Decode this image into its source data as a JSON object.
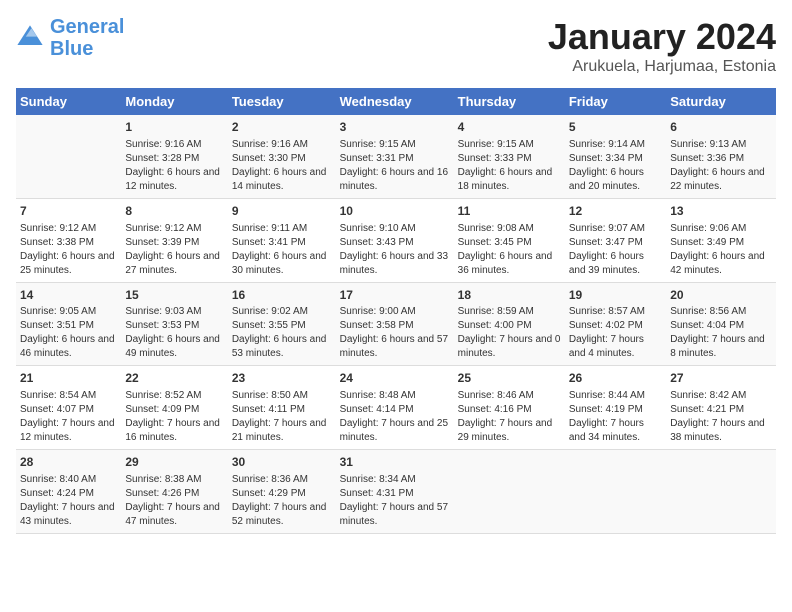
{
  "logo": {
    "line1": "General",
    "line2": "Blue"
  },
  "title": "January 2024",
  "subtitle": "Arukuela, Harjumaa, Estonia",
  "weekdays": [
    "Sunday",
    "Monday",
    "Tuesday",
    "Wednesday",
    "Thursday",
    "Friday",
    "Saturday"
  ],
  "weeks": [
    [
      {
        "day": "",
        "sunrise": "",
        "sunset": "",
        "daylight": ""
      },
      {
        "day": "1",
        "sunrise": "Sunrise: 9:16 AM",
        "sunset": "Sunset: 3:28 PM",
        "daylight": "Daylight: 6 hours and 12 minutes."
      },
      {
        "day": "2",
        "sunrise": "Sunrise: 9:16 AM",
        "sunset": "Sunset: 3:30 PM",
        "daylight": "Daylight: 6 hours and 14 minutes."
      },
      {
        "day": "3",
        "sunrise": "Sunrise: 9:15 AM",
        "sunset": "Sunset: 3:31 PM",
        "daylight": "Daylight: 6 hours and 16 minutes."
      },
      {
        "day": "4",
        "sunrise": "Sunrise: 9:15 AM",
        "sunset": "Sunset: 3:33 PM",
        "daylight": "Daylight: 6 hours and 18 minutes."
      },
      {
        "day": "5",
        "sunrise": "Sunrise: 9:14 AM",
        "sunset": "Sunset: 3:34 PM",
        "daylight": "Daylight: 6 hours and 20 minutes."
      },
      {
        "day": "6",
        "sunrise": "Sunrise: 9:13 AM",
        "sunset": "Sunset: 3:36 PM",
        "daylight": "Daylight: 6 hours and 22 minutes."
      }
    ],
    [
      {
        "day": "7",
        "sunrise": "Sunrise: 9:12 AM",
        "sunset": "Sunset: 3:38 PM",
        "daylight": "Daylight: 6 hours and 25 minutes."
      },
      {
        "day": "8",
        "sunrise": "Sunrise: 9:12 AM",
        "sunset": "Sunset: 3:39 PM",
        "daylight": "Daylight: 6 hours and 27 minutes."
      },
      {
        "day": "9",
        "sunrise": "Sunrise: 9:11 AM",
        "sunset": "Sunset: 3:41 PM",
        "daylight": "Daylight: 6 hours and 30 minutes."
      },
      {
        "day": "10",
        "sunrise": "Sunrise: 9:10 AM",
        "sunset": "Sunset: 3:43 PM",
        "daylight": "Daylight: 6 hours and 33 minutes."
      },
      {
        "day": "11",
        "sunrise": "Sunrise: 9:08 AM",
        "sunset": "Sunset: 3:45 PM",
        "daylight": "Daylight: 6 hours and 36 minutes."
      },
      {
        "day": "12",
        "sunrise": "Sunrise: 9:07 AM",
        "sunset": "Sunset: 3:47 PM",
        "daylight": "Daylight: 6 hours and 39 minutes."
      },
      {
        "day": "13",
        "sunrise": "Sunrise: 9:06 AM",
        "sunset": "Sunset: 3:49 PM",
        "daylight": "Daylight: 6 hours and 42 minutes."
      }
    ],
    [
      {
        "day": "14",
        "sunrise": "Sunrise: 9:05 AM",
        "sunset": "Sunset: 3:51 PM",
        "daylight": "Daylight: 6 hours and 46 minutes."
      },
      {
        "day": "15",
        "sunrise": "Sunrise: 9:03 AM",
        "sunset": "Sunset: 3:53 PM",
        "daylight": "Daylight: 6 hours and 49 minutes."
      },
      {
        "day": "16",
        "sunrise": "Sunrise: 9:02 AM",
        "sunset": "Sunset: 3:55 PM",
        "daylight": "Daylight: 6 hours and 53 minutes."
      },
      {
        "day": "17",
        "sunrise": "Sunrise: 9:00 AM",
        "sunset": "Sunset: 3:58 PM",
        "daylight": "Daylight: 6 hours and 57 minutes."
      },
      {
        "day": "18",
        "sunrise": "Sunrise: 8:59 AM",
        "sunset": "Sunset: 4:00 PM",
        "daylight": "Daylight: 7 hours and 0 minutes."
      },
      {
        "day": "19",
        "sunrise": "Sunrise: 8:57 AM",
        "sunset": "Sunset: 4:02 PM",
        "daylight": "Daylight: 7 hours and 4 minutes."
      },
      {
        "day": "20",
        "sunrise": "Sunrise: 8:56 AM",
        "sunset": "Sunset: 4:04 PM",
        "daylight": "Daylight: 7 hours and 8 minutes."
      }
    ],
    [
      {
        "day": "21",
        "sunrise": "Sunrise: 8:54 AM",
        "sunset": "Sunset: 4:07 PM",
        "daylight": "Daylight: 7 hours and 12 minutes."
      },
      {
        "day": "22",
        "sunrise": "Sunrise: 8:52 AM",
        "sunset": "Sunset: 4:09 PM",
        "daylight": "Daylight: 7 hours and 16 minutes."
      },
      {
        "day": "23",
        "sunrise": "Sunrise: 8:50 AM",
        "sunset": "Sunset: 4:11 PM",
        "daylight": "Daylight: 7 hours and 21 minutes."
      },
      {
        "day": "24",
        "sunrise": "Sunrise: 8:48 AM",
        "sunset": "Sunset: 4:14 PM",
        "daylight": "Daylight: 7 hours and 25 minutes."
      },
      {
        "day": "25",
        "sunrise": "Sunrise: 8:46 AM",
        "sunset": "Sunset: 4:16 PM",
        "daylight": "Daylight: 7 hours and 29 minutes."
      },
      {
        "day": "26",
        "sunrise": "Sunrise: 8:44 AM",
        "sunset": "Sunset: 4:19 PM",
        "daylight": "Daylight: 7 hours and 34 minutes."
      },
      {
        "day": "27",
        "sunrise": "Sunrise: 8:42 AM",
        "sunset": "Sunset: 4:21 PM",
        "daylight": "Daylight: 7 hours and 38 minutes."
      }
    ],
    [
      {
        "day": "28",
        "sunrise": "Sunrise: 8:40 AM",
        "sunset": "Sunset: 4:24 PM",
        "daylight": "Daylight: 7 hours and 43 minutes."
      },
      {
        "day": "29",
        "sunrise": "Sunrise: 8:38 AM",
        "sunset": "Sunset: 4:26 PM",
        "daylight": "Daylight: 7 hours and 47 minutes."
      },
      {
        "day": "30",
        "sunrise": "Sunrise: 8:36 AM",
        "sunset": "Sunset: 4:29 PM",
        "daylight": "Daylight: 7 hours and 52 minutes."
      },
      {
        "day": "31",
        "sunrise": "Sunrise: 8:34 AM",
        "sunset": "Sunset: 4:31 PM",
        "daylight": "Daylight: 7 hours and 57 minutes."
      },
      {
        "day": "",
        "sunrise": "",
        "sunset": "",
        "daylight": ""
      },
      {
        "day": "",
        "sunrise": "",
        "sunset": "",
        "daylight": ""
      },
      {
        "day": "",
        "sunrise": "",
        "sunset": "",
        "daylight": ""
      }
    ]
  ]
}
